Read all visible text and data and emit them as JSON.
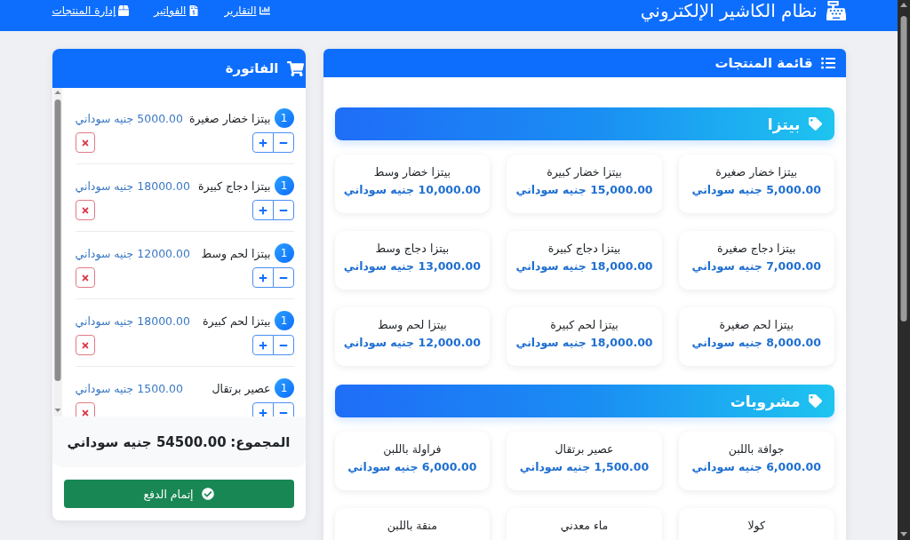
{
  "navbar": {
    "title": "نظام الكاشير الإلكتروني",
    "links": [
      {
        "label": "التقارير"
      },
      {
        "label": "الفواتير"
      },
      {
        "label": "إدارة المنتجات"
      }
    ]
  },
  "products_panel": {
    "title": "قائمة المنتجات",
    "categories": [
      {
        "name": "بيتزا",
        "products": [
          {
            "name": "بيتزا خضار صغيرة",
            "price": "5,000.00 جنيه سوداني"
          },
          {
            "name": "بيتزا خضار كبيرة",
            "price": "15,000.00 جنيه سوداني"
          },
          {
            "name": "بيتزا خضار وسط",
            "price": "10,000.00 جنيه سوداني"
          },
          {
            "name": "بيتزا دجاج صغيرة",
            "price": "7,000.00 جنيه سوداني"
          },
          {
            "name": "بيتزا دجاج كبيرة",
            "price": "18,000.00 جنيه سوداني"
          },
          {
            "name": "بيتزا دجاج وسط",
            "price": "13,000.00 جنيه سوداني"
          },
          {
            "name": "بيتزا لحم صغيرة",
            "price": "8,000.00 جنيه سوداني"
          },
          {
            "name": "بيتزا لحم كبيرة",
            "price": "18,000.00 جنيه سوداني"
          },
          {
            "name": "بيتزا لحم وسط",
            "price": "12,000.00 جنيه سوداني"
          }
        ]
      },
      {
        "name": "مشروبات",
        "products": [
          {
            "name": "جوافة باللبن",
            "price": "6,000.00 جنيه سوداني"
          },
          {
            "name": "عصير برتقال",
            "price": "1,500.00 جنيه سوداني"
          },
          {
            "name": "فراولة باللبن",
            "price": "6,000.00 جنيه سوداني"
          },
          {
            "name": "كولا"
          },
          {
            "name": "ماء معدني"
          },
          {
            "name": "منقة باللبن"
          }
        ]
      }
    ]
  },
  "invoice": {
    "title": "الفاتورة",
    "items": [
      {
        "quantity": "1",
        "name": "بيتزا خضار صغيرة",
        "price": "5000.00 جنيه سوداني"
      },
      {
        "quantity": "1",
        "name": "بيتزا دجاج كبيرة",
        "price": "18000.00 جنيه سوداني"
      },
      {
        "quantity": "1",
        "name": "بيتزا لحم وسط",
        "price": "12000.00 جنيه سوداني"
      },
      {
        "quantity": "1",
        "name": "بيتزا لحم كبيرة",
        "price": "18000.00 جنيه سوداني"
      },
      {
        "quantity": "1",
        "name": "عصير برتقال",
        "price": "1500.00 جنيه سوداني"
      }
    ],
    "total_label": "المجموع:",
    "total": "54500.00 جنيه سوداني",
    "pay_button": "إتمام الدفع"
  }
}
